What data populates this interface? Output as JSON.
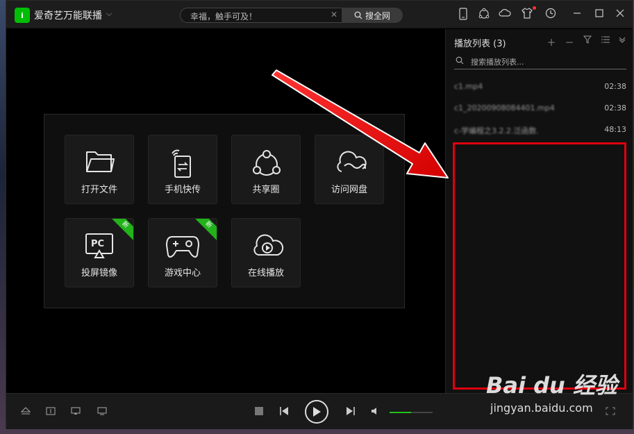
{
  "app": {
    "logo_text": "i",
    "title": "爱奇艺万能联播",
    "title_arrow": "⌵"
  },
  "search": {
    "placeholder": "幸福，触手可及！",
    "clear": "✕",
    "button_label": "搜全网"
  },
  "tiles": [
    {
      "label": "打开文件",
      "icon": "folder-icon"
    },
    {
      "label": "手机快传",
      "icon": "phone-transfer-icon"
    },
    {
      "label": "共享圈",
      "icon": "share-circle-icon"
    },
    {
      "label": "访问网盘",
      "icon": "cloud-disk-icon"
    },
    {
      "label": "投屏镜像",
      "icon": "pc-mirror-icon",
      "badge": "新"
    },
    {
      "label": "游戏中心",
      "icon": "gamepad-icon",
      "badge": "新"
    },
    {
      "label": "在线播放",
      "icon": "cloud-play-icon"
    }
  ],
  "playlist": {
    "title": "播放列表 (3)",
    "search_placeholder": "搜索播放列表...",
    "items": [
      {
        "name": "c1.mp4",
        "duration": "02:38"
      },
      {
        "name": "c1_20200908084401.mp4",
        "duration": "02:38"
      },
      {
        "name": "c-学编程之3.2.2.泛函数.",
        "duration": "48:13"
      }
    ]
  },
  "watermark": {
    "logo": "Bai du 经验",
    "url": "jingyan.baidu.com"
  },
  "colors": {
    "accent": "#00be06",
    "highlight": "#e0000e",
    "volume": "#22c21a"
  },
  "volume_level": 0.5
}
